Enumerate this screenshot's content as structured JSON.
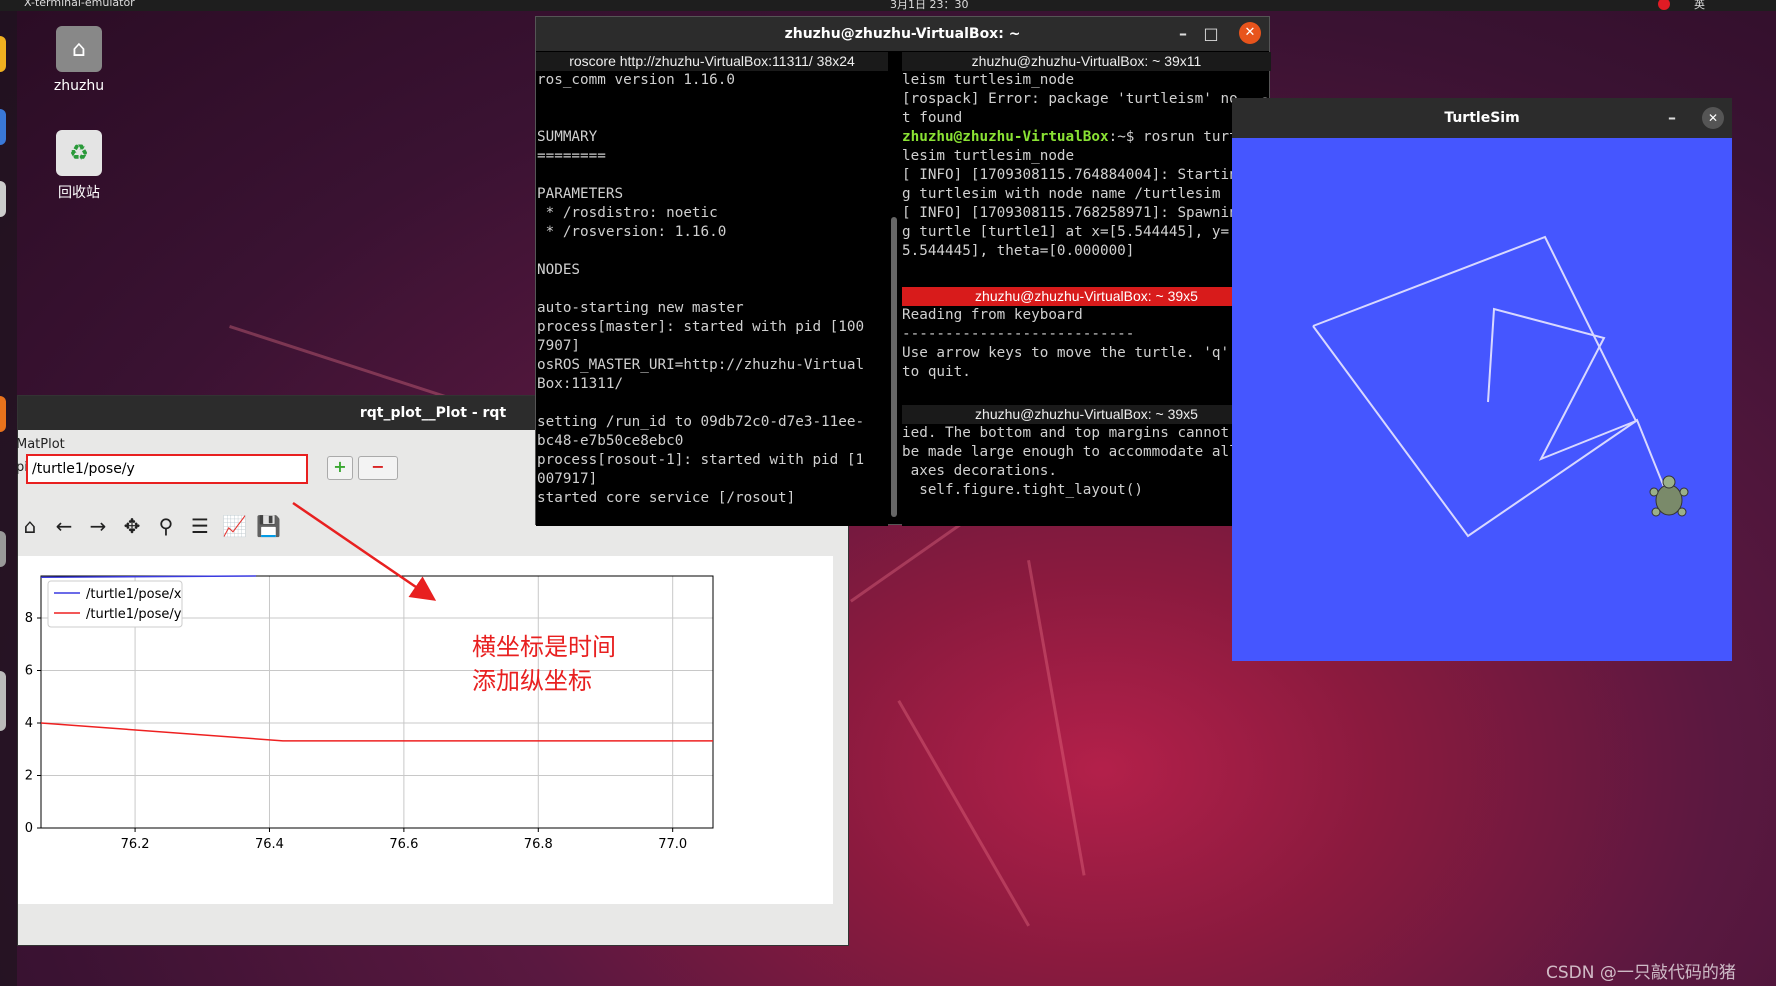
{
  "topbar": {
    "app": "X-terminal-emulator",
    "clock": "3月1日 23：30",
    "lang": "英"
  },
  "desktop": {
    "home_label": "zhuzhu",
    "trash_label": "回收站"
  },
  "rqt": {
    "title": "rqt_plot__Plot - rqt",
    "matplot_label": "MatPlot",
    "topic_label": "pic",
    "topic_value": "/turtle1/pose/y",
    "add_label": "+",
    "remove_label": "−",
    "annotation_line1": "横坐标是时间",
    "annotation_line2": "添加纵坐标"
  },
  "chart_data": {
    "type": "line",
    "xlim": [
      76.06,
      77.06
    ],
    "ylim": [
      0,
      9.6
    ],
    "xticks": [
      "76.2",
      "76.4",
      "76.6",
      "76.8",
      "77.0"
    ],
    "xtick_values": [
      76.2,
      76.4,
      76.6,
      76.8,
      77.0
    ],
    "yticks": [
      "0",
      "2",
      "4",
      "6",
      "8"
    ],
    "ytick_values": [
      0,
      2,
      4,
      6,
      8
    ],
    "grid": true,
    "legend_position": "top-left",
    "series": [
      {
        "name": "/turtle1/pose/x",
        "color": "#3a3ae0",
        "x": [
          76.06,
          76.38
        ],
        "y": [
          9.55,
          9.72
        ]
      },
      {
        "name": "/turtle1/pose/y",
        "color": "#ee2020",
        "x": [
          76.06,
          76.42,
          77.06
        ],
        "y": [
          4.0,
          3.32,
          3.32
        ]
      }
    ]
  },
  "terminal": {
    "title": "zhuzhu@zhuzhu-VirtualBox: ~",
    "pane1": {
      "header": "roscore http://zhuzhu-VirtualBox:11311/ 38x24",
      "text": "ros_comm version 1.16.0\n\n\nSUMMARY\n========\n\nPARAMETERS\n * /rosdistro: noetic\n * /rosversion: 1.16.0\n\nNODES\n\nauto-starting new master\nprocess[master]: started with pid [100\n7907]\nosROS_MASTER_URI=http://zhuzhu-Virtual\nBox:11311/\n\nsetting /run_id to 09db72c0-d7e3-11ee-\nbc48-e7b50ce8ebc0\nprocess[rosout-1]: started with pid [1\n007917]\nstarted core service [/rosout]"
    },
    "pane2": {
      "header": "zhuzhu@zhuzhu-VirtualBox: ~ 39x11",
      "text_a": "leism turtlesim_node\n[rospack] Error: package 'turtleism' no\nt found",
      "prompt": "zhuzhu@zhuzhu-VirtualBox",
      "text_b": ":~$ rosrun turt\nlesim turtlesim_node\n[ INFO] [1709308115.764884004]: Startin\ng turtlesim with node name /turtlesim\n[ INFO] [1709308115.768258971]: Spawnin\ng turtle [turtle1] at x=[5.544445], y=[\n5.544445], theta=[0.000000]"
    },
    "pane3": {
      "header": "zhuzhu@zhuzhu-VirtualBox: ~ 39x5",
      "text": "Reading from keyboard\n---------------------------\nUse arrow keys to move the turtle. 'q'\nto quit."
    },
    "pane4": {
      "header": "zhuzhu@zhuzhu-VirtualBox: ~ 39x5",
      "text": "ied. The bottom and top margins cannot\nbe made large enough to accommodate all\n axes decorations.\n  self.figure.tight_layout()"
    }
  },
  "turtlesim": {
    "title": "TurtleSim",
    "bg": "#4556ff"
  },
  "watermark": "CSDN @一只敲代码的猪"
}
